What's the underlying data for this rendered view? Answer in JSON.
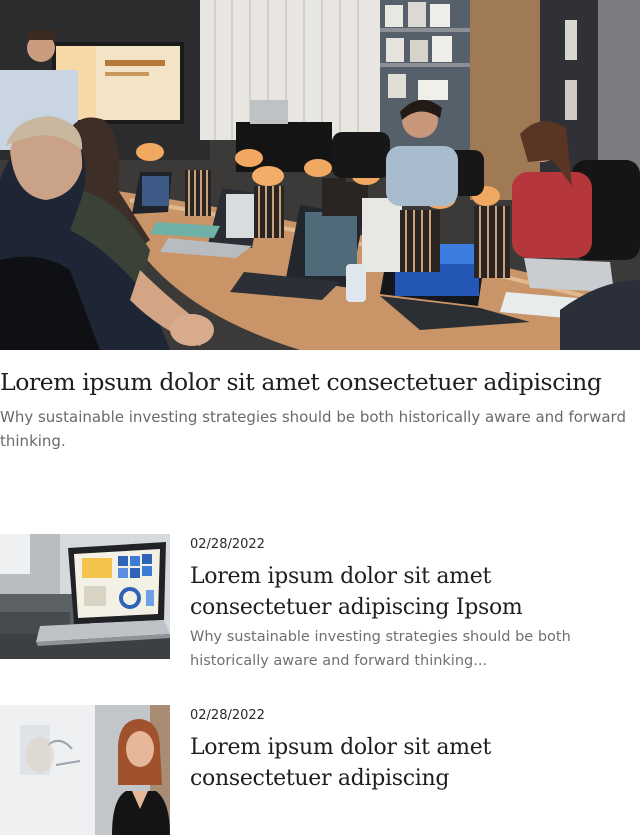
{
  "hero": {
    "title": "Lorem ipsum dolor sit amet consectetuer adipiscing",
    "excerpt": "Why sustainable investing strategies should be both historically aware and forward thinking."
  },
  "posts": [
    {
      "date": "02/28/2022",
      "title": "Lorem ipsum dolor sit amet consectetuer adipiscing Ipsom",
      "excerpt": "Why sustainable investing strategies should be both historically aware and forward thinking..."
    },
    {
      "date": "02/28/2022",
      "title": "Lorem ipsum dolor sit amet consectetuer adipiscing",
      "excerpt": ""
    }
  ],
  "colors": {
    "title": "#1e1e1e",
    "excerpt": "#6a6a6a",
    "date": "#2a2a2a"
  },
  "images": {
    "hero": "meeting-room-photo",
    "post_1": "laptop-dashboard-photo",
    "post_2": "woman-whiteboard-photo"
  }
}
